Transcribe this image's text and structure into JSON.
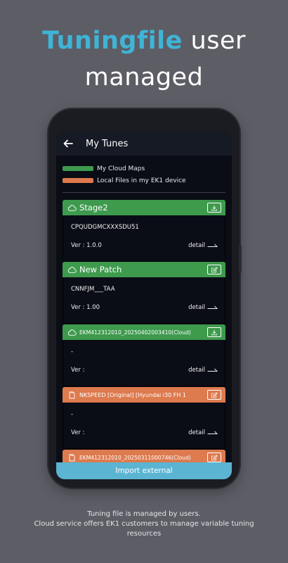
{
  "headline": {
    "accent": "Tuningfile",
    "rest_line1": " user",
    "line2": "managed"
  },
  "appbar": {
    "title": "My Tunes"
  },
  "legend": {
    "items": [
      {
        "label": "My Cloud Maps",
        "color": "#3e9a4d"
      },
      {
        "label": "Local Files in my EK1 device",
        "color": "#dd7a4e"
      }
    ]
  },
  "cards": [
    {
      "title": "Stage2",
      "name": "CPQUDGMCXXXSDU51",
      "ver": "Ver : 1.0.0",
      "detail": "detail",
      "type": "cloud",
      "action": "download"
    },
    {
      "title": "New Patch",
      "name": "CNNFJM___TAA",
      "ver": "Ver : 1.00",
      "detail": "detail",
      "type": "cloud",
      "action": "edit"
    },
    {
      "title": "EKM412312010_20250402003410(Cloud)",
      "name": "-",
      "ver": "Ver :",
      "detail": "detail",
      "type": "cloud",
      "action": "download"
    },
    {
      "title": "NKSPEED [Original] [Hyundai i30 FH 1",
      "name": "-",
      "ver": "Ver :",
      "detail": "detail",
      "type": "local",
      "action": "edit"
    },
    {
      "title": "EKM412312010_20250311000746(Cloud)",
      "type": "local",
      "action": "edit"
    }
  ],
  "import_button": {
    "label": "Import external"
  },
  "caption": {
    "line1": "Tuning file is managed by users.",
    "line2": "Cloud service offers EK1 customers to manage variable tuning",
    "line3": "resources"
  }
}
